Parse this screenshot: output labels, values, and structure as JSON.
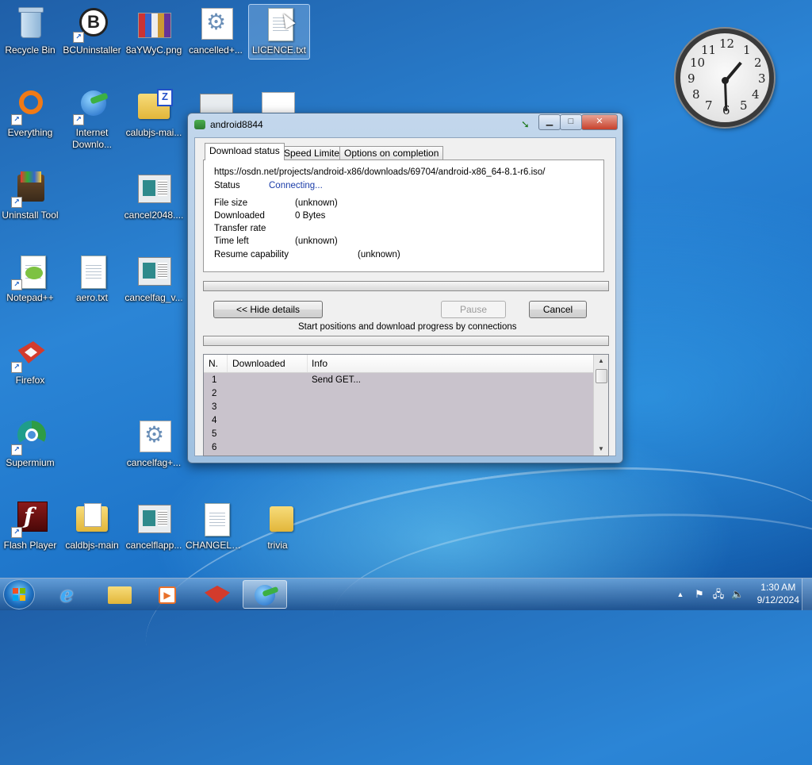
{
  "desktop": {
    "icons": [
      {
        "label": "Recycle Bin"
      },
      {
        "label": "BCUninstaller"
      },
      {
        "label": "8aYWyC.png"
      },
      {
        "label": "cancelled+..."
      },
      {
        "label": "LICENCE.txt"
      },
      {
        "label": "Everything"
      },
      {
        "label": "Internet Downlo..."
      },
      {
        "label": "calubjs-mai..."
      },
      {
        "label": "Uninstall Tool"
      },
      {
        "label": "cancel2048...."
      },
      {
        "label": "Notepad++"
      },
      {
        "label": "aero.txt"
      },
      {
        "label": "cancelfag_v..."
      },
      {
        "label": "Firefox"
      },
      {
        "label": "Supermium"
      },
      {
        "label": "cancelfag+..."
      },
      {
        "label": "Flash Player"
      },
      {
        "label": "caldbjs-main"
      },
      {
        "label": "cancelflapp..."
      },
      {
        "label": "CHANGELO..."
      },
      {
        "label": "trivia"
      }
    ]
  },
  "gadget_clock": {
    "numbers": [
      "12",
      "1",
      "2",
      "3",
      "4",
      "5",
      "6",
      "7",
      "8",
      "9",
      "10",
      "11"
    ]
  },
  "dialog": {
    "title": "android8844",
    "controls": {
      "minimize": "▁",
      "maximize": "□",
      "close": "✕"
    },
    "tabs": [
      {
        "label": "Download status",
        "active": true
      },
      {
        "label": "Speed Limiter",
        "active": false
      },
      {
        "label": "Options on completion",
        "active": false
      }
    ],
    "url": "https://osdn.net/projects/android-x86/downloads/69704/android-x86_64-8.1-r6.iso/",
    "status_label": "Status",
    "status_value": "Connecting...",
    "fields": [
      {
        "label": "File size",
        "value": "(unknown)"
      },
      {
        "label": "Downloaded",
        "value": "0 Bytes"
      },
      {
        "label": "Transfer rate",
        "value": ""
      },
      {
        "label": "Time left",
        "value": "(unknown)"
      },
      {
        "label": "Resume capability",
        "value": "(unknown)"
      }
    ],
    "progress": 0,
    "buttons": {
      "hide_details": "<< Hide details",
      "pause": "Pause",
      "cancel": "Cancel"
    },
    "connections_caption": "Start positions and download progress by connections",
    "list": {
      "headers": [
        "N.",
        "Downloaded",
        "Info"
      ],
      "rows": [
        {
          "n": "1",
          "downloaded": "",
          "info": "Send GET..."
        },
        {
          "n": "2",
          "downloaded": "",
          "info": ""
        },
        {
          "n": "3",
          "downloaded": "",
          "info": ""
        },
        {
          "n": "4",
          "downloaded": "",
          "info": ""
        },
        {
          "n": "5",
          "downloaded": "",
          "info": ""
        },
        {
          "n": "6",
          "downloaded": "",
          "info": ""
        }
      ]
    }
  },
  "taskbar": {
    "time": "1:30 AM",
    "date": "9/12/2024",
    "tray": {
      "overflow": "▲"
    }
  },
  "colors": {
    "accent": "#1a3ca8",
    "desktop": "#2b85d6"
  }
}
